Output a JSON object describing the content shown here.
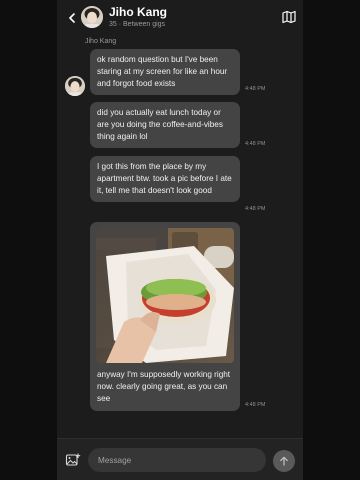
{
  "header": {
    "title": "Jiho Kang",
    "subtitle": "35 · Between gigs",
    "back_icon": "chevron-left-icon",
    "map_icon": "map-icon"
  },
  "thread": {
    "sender_name": "Jiho Kang",
    "messages": [
      {
        "text": "ok random question but I've been staring at my screen for like an hour and forgot food exists",
        "time": "4:48 PM"
      },
      {
        "text": "did you actually eat lunch today or are you doing the coffee-and-vibes thing again lol",
        "time": "4:48 PM"
      },
      {
        "text": "I got this from the place by my apartment btw. took a pic before I ate it, tell me that doesn't look good",
        "time": "4:48 PM"
      },
      {
        "text": "anyway I'm supposedly working right now. clearly going great, as you can see",
        "time": "4:48 PM",
        "image": "sandwich-photo"
      }
    ]
  },
  "composer": {
    "placeholder": "Message",
    "attach_icon": "image-attach-icon",
    "send_icon": "arrow-up-icon"
  },
  "colors": {
    "background": "#1c1c1c",
    "bubble": "#444444",
    "composer": "#232323",
    "input": "#363636",
    "send_button": "#5a5a5a"
  }
}
